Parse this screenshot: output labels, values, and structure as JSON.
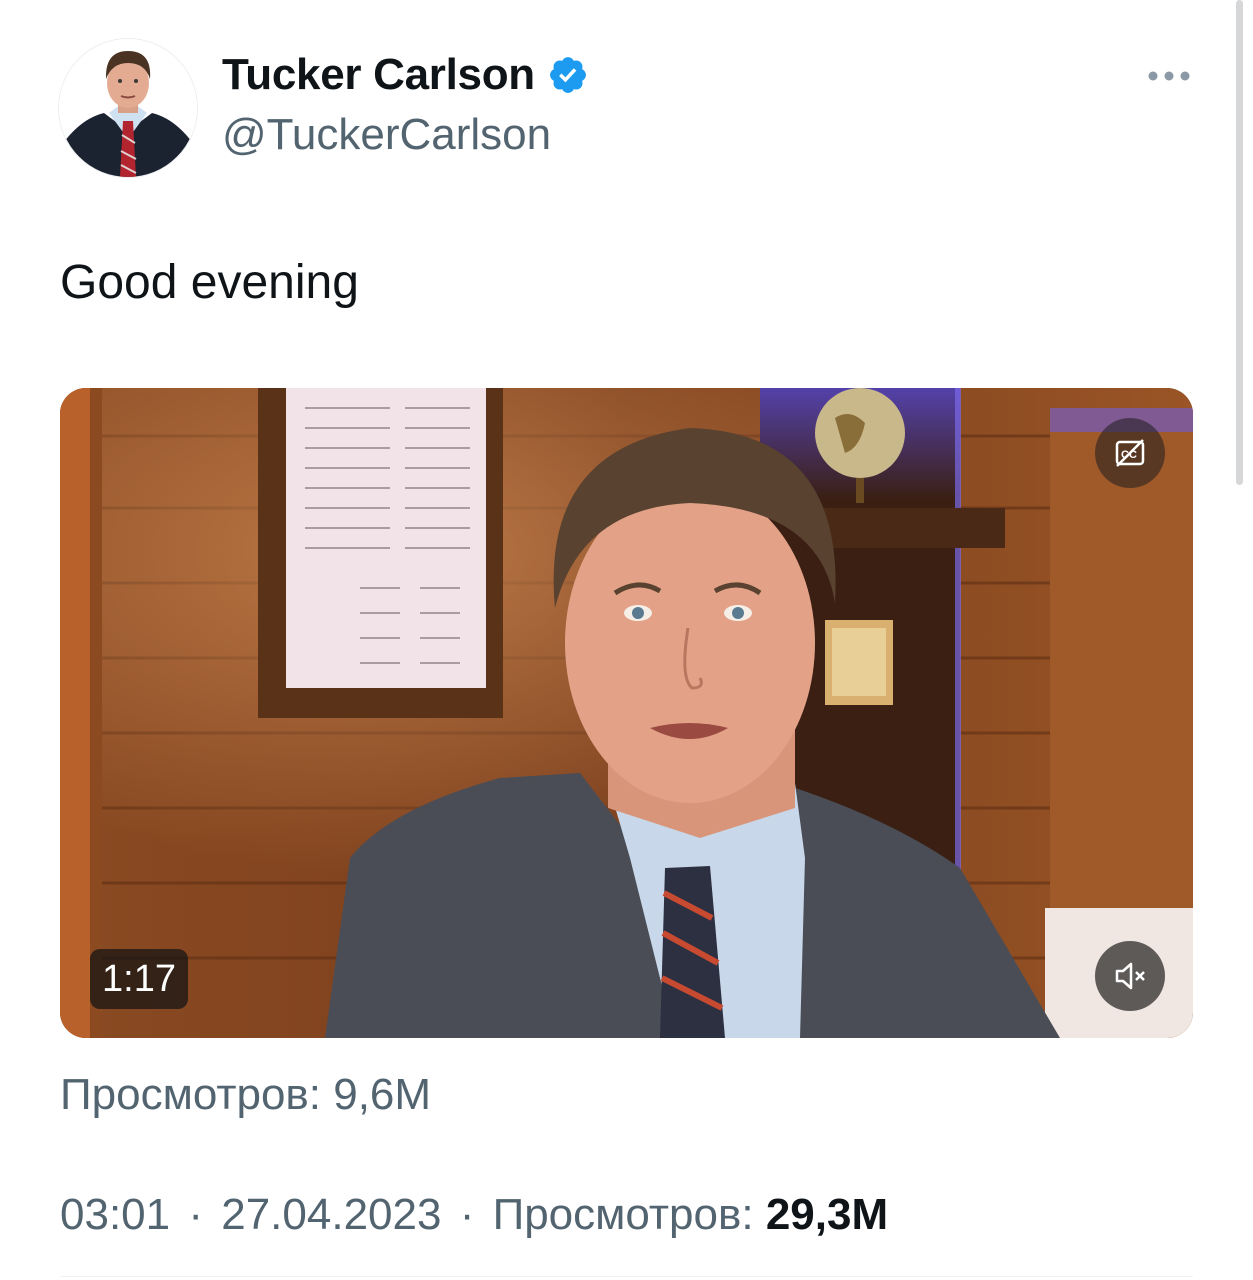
{
  "author": {
    "display_name": "Tucker Carlson",
    "handle": "@TuckerCarlson",
    "verified": true,
    "avatar_icon": "profile-photo"
  },
  "tweet": {
    "text": "Good evening"
  },
  "media": {
    "type": "video",
    "duration": "1:17",
    "views_label": "Просмотров: 9,6M",
    "controls": {
      "captions_icon": "closed-captions-off-icon",
      "mute_icon": "muted-speaker-icon"
    }
  },
  "meta": {
    "time": "03:01",
    "date": "27.04.2023",
    "separator": "·",
    "views_prefix": "Просмотров:",
    "views_value": "29,3M"
  },
  "icons": {
    "more": "more-options-icon",
    "verified": "verified-badge-icon"
  },
  "colors": {
    "accent": "#1d9bf0",
    "text_primary": "#0f1419",
    "text_secondary": "#536471"
  }
}
